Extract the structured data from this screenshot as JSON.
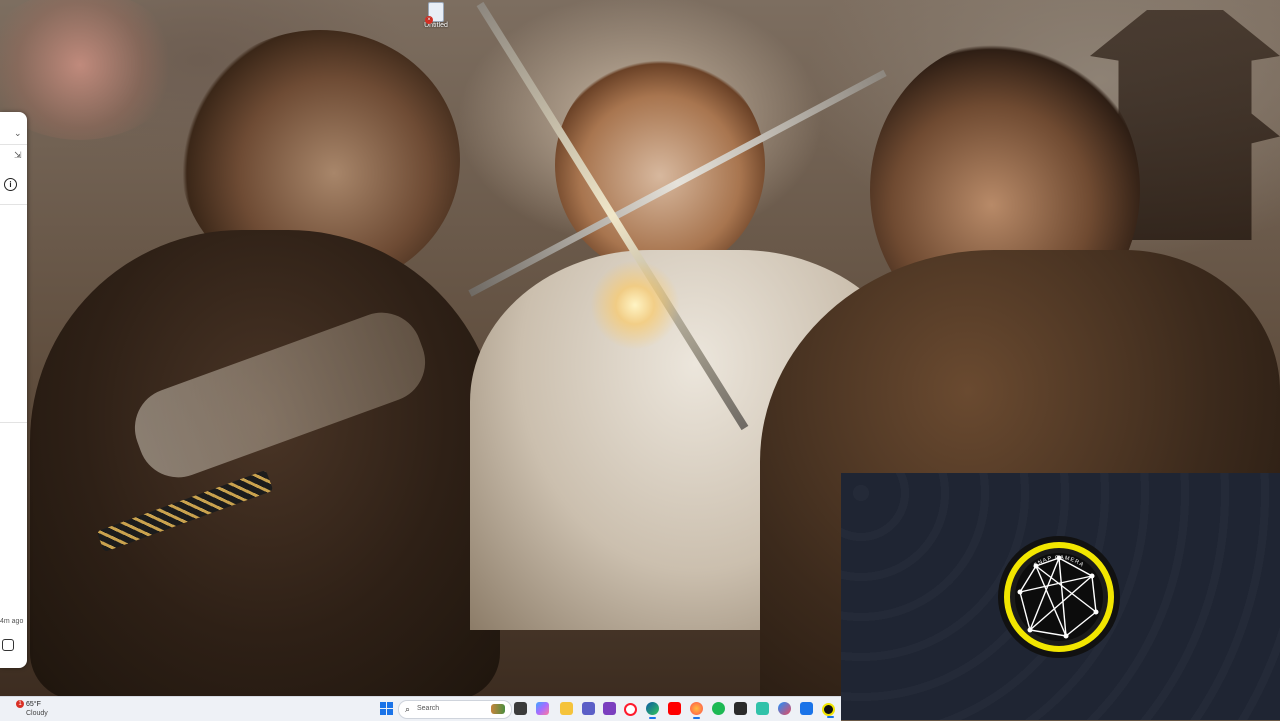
{
  "desktop": {
    "icons": [
      {
        "label": "Untitled",
        "icon": "document-error-icon"
      }
    ]
  },
  "side_panel": {
    "controls": [
      "chevron-down-icon",
      "pin-icon",
      "info-icon"
    ],
    "timestamp": "4m ago",
    "note_icon": "sticky-note-icon"
  },
  "camera_overlay": {
    "logo_text": "SNAP CAMERA",
    "accent_color": "#f2e600",
    "background_color": "#1f2533"
  },
  "taskbar": {
    "weather": {
      "badge": "1",
      "temperature": "65°F",
      "condition": "Cloudy"
    },
    "search_placeholder": "Search",
    "apps": [
      "task-view-icon",
      "copilot-icon",
      "file-explorer-icon",
      "teams-icon",
      "opera-icon",
      "edge-icon",
      "youtube-icon",
      "firefox-icon",
      "spotify-icon",
      "notepad-icon",
      "mail-icon",
      "store-icon",
      "snap-camera-icon"
    ],
    "accent_color": "#1a73e8"
  }
}
